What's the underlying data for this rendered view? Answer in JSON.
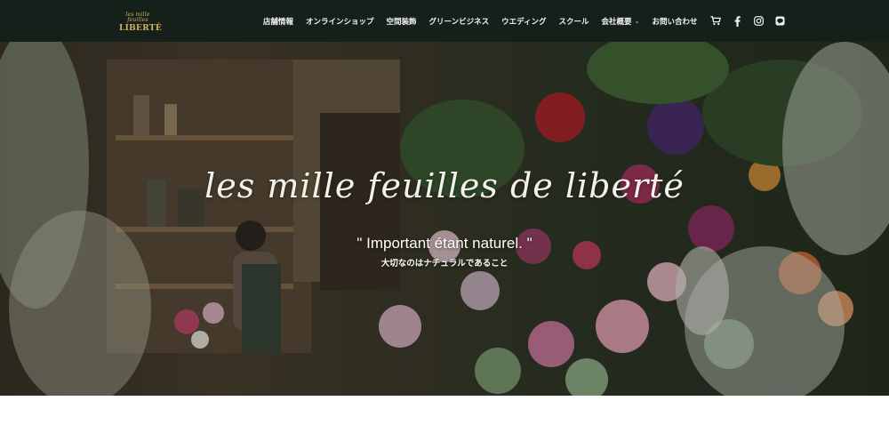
{
  "logo": {
    "script_text": "les mille feuilles",
    "word_text": "LIBERTÉ"
  },
  "nav": {
    "items": [
      {
        "label": "店舗情報",
        "has_dropdown": false
      },
      {
        "label": "オンラインショップ",
        "has_dropdown": false
      },
      {
        "label": "空間装飾",
        "has_dropdown": false
      },
      {
        "label": "グリーンビジネス",
        "has_dropdown": false
      },
      {
        "label": "ウエディング",
        "has_dropdown": false
      },
      {
        "label": "スクール",
        "has_dropdown": false
      },
      {
        "label": "会社概要",
        "has_dropdown": true
      },
      {
        "label": "お問い合わせ",
        "has_dropdown": false
      }
    ],
    "icons": [
      "cart-icon",
      "facebook-icon",
      "instagram-icon",
      "line-icon"
    ],
    "caret_glyph": "⌄"
  },
  "hero": {
    "title": "les mille feuilles de liberté",
    "subtitle": "\" Important étant naturel. \"",
    "subtitle_jp": "大切なのはナチュラルであること"
  },
  "colors": {
    "nav_bg": "#15201a",
    "logo_gold": "#d6b25e",
    "nav_text": "#f3f3f3"
  }
}
